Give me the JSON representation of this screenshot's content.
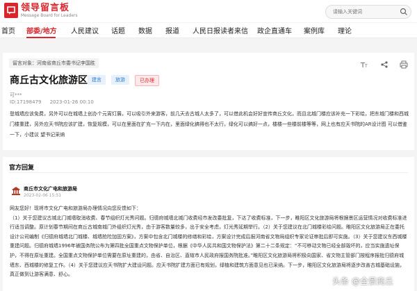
{
  "header": {
    "logo_title": "领导留言板",
    "logo_subtitle": "Message Board for Leaders",
    "search_placeholder": "请输入关键词"
  },
  "nav": {
    "items": [
      {
        "label": "首页",
        "active": false
      },
      {
        "label": "部委/地方",
        "active": true
      },
      {
        "label": "人民建议",
        "active": false
      },
      {
        "label": "话题",
        "active": false
      },
      {
        "label": "数据",
        "active": false
      },
      {
        "label": "报道",
        "active": false
      },
      {
        "label": "人民日报读者来信",
        "active": false
      },
      {
        "label": "政企直通车",
        "active": false
      },
      {
        "label": "案例库",
        "active": false
      },
      {
        "label": "理论",
        "active": false
      }
    ]
  },
  "message": {
    "target": "留言对象：河南省商丘市委书记李国胜",
    "title": "商丘古文化旅游区",
    "badges": [
      "建言",
      "旅游",
      "已办理"
    ],
    "author": "可***",
    "id": "ID:17198479",
    "date": "2023-01-26 00:10",
    "body": "登城墙应该免费，另外可以在城墙上创办个元宵灯展，可以吸引外来游客，前几天去古城人太多了，可以借此机会好好宣传商丘文化，而且北城门楼应该补充一下彩绘，把东城门楼和西城门楼重建，另外应天书院应该扩建，恢复规模，可以在里面在扩充一下内在，里面绿化搞得也不太行，绿化可以搞好一点，楼楼一些楼前楼等等，网上也有应天书院的AR设计图  可以借鉴一下，小建议 望书记采纳"
  },
  "reply": {
    "heading": "官方回复",
    "org": "商丘市文化广电和旅游局",
    "time": "2023-02-06 15:51",
    "greeting": "网友您好！现将市文化广电和旅游局办理情况向您反馈如下：",
    "body": "（1）关于您建议古城北门城墙取消收费、春节组织灯光秀问题。归德府城墙北城门收费经市发改委批复，下达了收费标准，下一步，睢阳区文化旅游局将根据景区运营情况对收费标准进行适当调整。原计划春节期间在商丘古城南城门外组织灯光秀，由于游客数量较多，出于安全考虑，灯光秀延期举行。（2）关于您建议在北门城楼彩绘问题。睢阳区文化旅游局正在委托设计公司编制《归德府城墙北门城楼、城墙抢险加固方案》，方案中包含北门城楼的修缮和彩绘，方案设计完成后报河南省文物局组织专家论证审批后即可实施。（3）关于您建议东西城楼重建问题。归德府城墙1996年被国务院公布为第四批全国重点文物保护单位，根据《中华人民共和国文物保护法》第二十二条规定：“不可移动文物已经全部毁坏的，应当实施遗址保护，不得在原址重建。全国重点文物保护单位需要在原址重建的，由省、自治区、直辖市人民政府报国务院批准。”睢阳区文化旅游局将积极向国家、省文物主管部门按程序报批归德府城墙东、西城楼的修复工作。（4）关于您建议应天书院扩大建设问题。应天书院扩建方面已有规划，绿植和建筑方面意见也已采纳。下一步，睢阳区文化旅游局将逐步改善古城基础设施，真正做到让游客满意、舒心。"
  },
  "watermark": "头条 @全景商丘",
  "colors": {
    "accent": "#d9252b",
    "tag_blue": "#2f7bd1"
  }
}
